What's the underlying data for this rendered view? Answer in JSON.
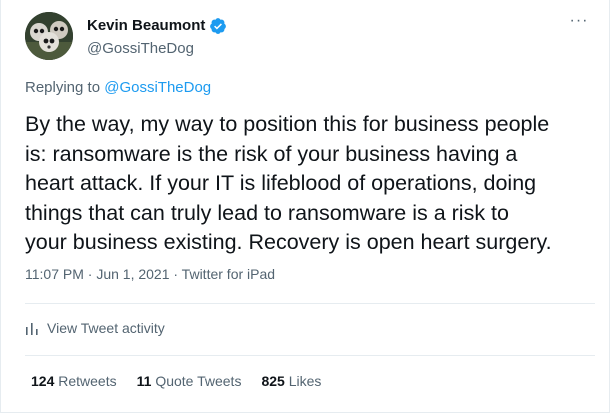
{
  "author": {
    "display_name": "Kevin Beaumont",
    "handle": "@GossiTheDog",
    "verified": true,
    "avatar_icon": "avatar-lemurs-image"
  },
  "reply": {
    "prefix": "Replying to ",
    "mention": "@GossiTheDog"
  },
  "tweet": {
    "text": "By the way, my way to position this for business people\nis: ransomware is the risk of your business having a\nheart attack. If your IT is lifeblood of operations, doing\nthings that can truly lead to ransomware is a risk to\nyour business existing. Recovery is open heart surgery.",
    "meta": "11:07 PM · Jun 1, 2021 · Twitter for iPad"
  },
  "actions": {
    "activity_label": "View Tweet activity",
    "more_glyph": "···"
  },
  "stats": [
    {
      "count": "124",
      "label": "Retweets"
    },
    {
      "count": "11",
      "label": "Quote Tweets"
    },
    {
      "count": "825",
      "label": "Likes"
    }
  ],
  "colors": {
    "accent": "#1d9bf0",
    "secondary_text": "#536471",
    "primary_text": "#0f1419",
    "divider": "#e6ecf0"
  }
}
